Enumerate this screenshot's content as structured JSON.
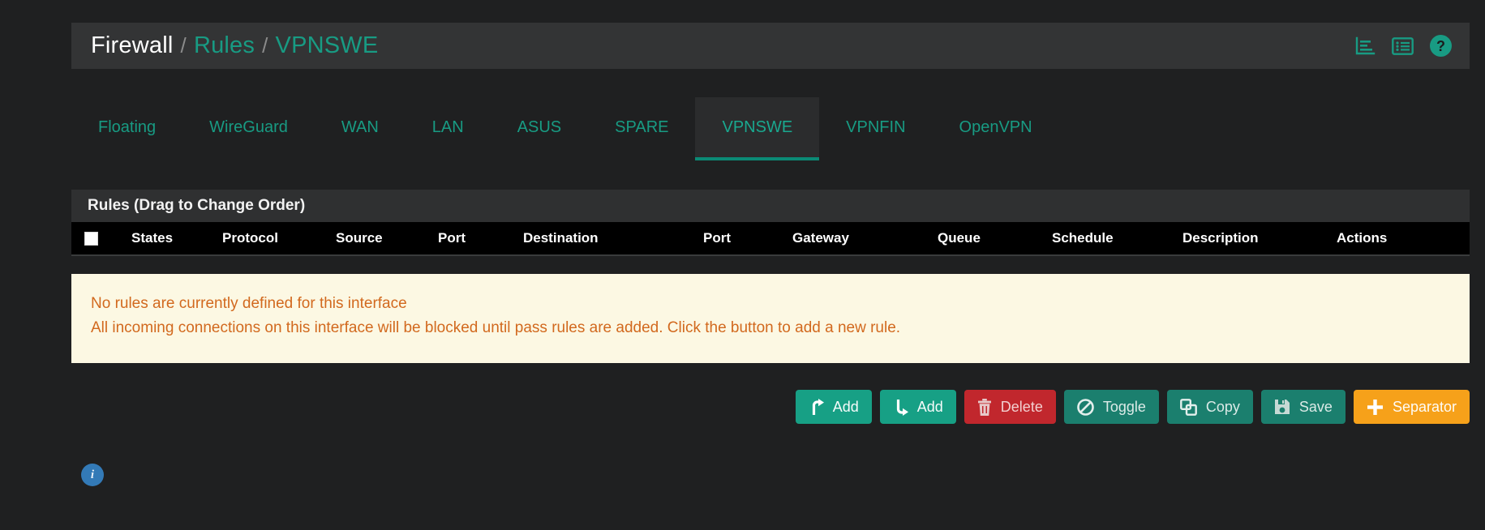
{
  "header": {
    "breadcrumb": {
      "root": "Firewall",
      "separator": "/",
      "section": "Rules",
      "current": "VPNSWE"
    },
    "icons": [
      {
        "name": "statistics-icon",
        "title": "Statistics"
      },
      {
        "name": "list-icon",
        "title": "List"
      },
      {
        "name": "help-icon",
        "label": "?"
      }
    ]
  },
  "tabs": [
    {
      "label": "Floating",
      "active": false
    },
    {
      "label": "WireGuard",
      "active": false
    },
    {
      "label": "WAN",
      "active": false
    },
    {
      "label": "LAN",
      "active": false
    },
    {
      "label": "ASUS",
      "active": false
    },
    {
      "label": "SPARE",
      "active": false
    },
    {
      "label": "VPNSWE",
      "active": true
    },
    {
      "label": "VPNFIN",
      "active": false
    },
    {
      "label": "OpenVPN",
      "active": false
    }
  ],
  "panel": {
    "title": "Rules (Drag to Change Order)",
    "columns": [
      "",
      "States",
      "Protocol",
      "Source",
      "Port",
      "Destination",
      "Port",
      "Gateway",
      "Queue",
      "Schedule",
      "Description",
      "Actions"
    ],
    "rows": []
  },
  "alert": {
    "line1": "No rules are currently defined for this interface",
    "line2": "All incoming connections on this interface will be blocked until pass rules are added. Click the button to add a new rule."
  },
  "buttons": [
    {
      "label": "Add",
      "icon": "arrow-up-icon",
      "style": "add"
    },
    {
      "label": "Add",
      "icon": "arrow-down-icon",
      "style": "add"
    },
    {
      "label": "Delete",
      "icon": "trash-icon",
      "style": "delete"
    },
    {
      "label": "Toggle",
      "icon": "ban-icon",
      "style": "neutral"
    },
    {
      "label": "Copy",
      "icon": "copy-icon",
      "style": "neutral"
    },
    {
      "label": "Save",
      "icon": "save-icon",
      "style": "save"
    },
    {
      "label": "Separator",
      "icon": "plus-icon",
      "style": "separator"
    }
  ],
  "footer": {
    "info_label": "i"
  },
  "colors": {
    "background": "#1f2021",
    "header_bar": "#333435",
    "accent_teal": "#189b83",
    "tab_active_border": "#0b8a75",
    "table_header": "#000000",
    "alert_bg": "#fcf8e3",
    "alert_text": "#d2691e",
    "btn_add": "#17a085",
    "btn_delete": "#c1272d",
    "btn_neutral": "#1b7f6e",
    "btn_separator": "#f6a11a",
    "info_blue": "#337ab7"
  }
}
